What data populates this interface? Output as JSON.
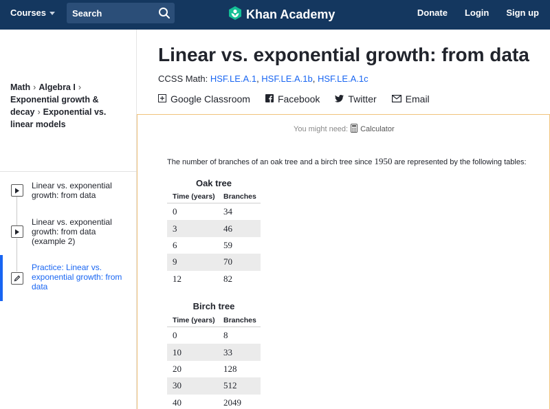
{
  "header": {
    "courses_label": "Courses",
    "search_label": "Search",
    "brand": "Khan Academy",
    "donate": "Donate",
    "login": "Login",
    "signup": "Sign up"
  },
  "breadcrumb": {
    "items": [
      "Math",
      "Algebra I",
      "Exponential growth & decay",
      "Exponential vs. linear models"
    ]
  },
  "sidebar": {
    "items": [
      {
        "icon": "play-icon",
        "label": "Linear vs. exponential growth: from data"
      },
      {
        "icon": "play-icon",
        "label": "Linear vs. exponential growth: from data (example 2)"
      },
      {
        "icon": "pencil-icon",
        "label": "Practice: Linear vs. exponential growth: from data",
        "active": true
      }
    ]
  },
  "main": {
    "title": "Linear vs. exponential growth: from data",
    "ccss_prefix": "CCSS Math: ",
    "ccss_links": [
      "HSF.LE.A.1",
      "HSF.LE.A.1b",
      "HSF.LE.A.1c"
    ],
    "share": {
      "google": "Google Classroom",
      "facebook": "Facebook",
      "twitter": "Twitter",
      "email": "Email"
    },
    "need_prefix": "You might need:",
    "need_tool": "Calculator",
    "problem_before": "The number of branches of an oak tree and a birch tree since ",
    "problem_year": "1950",
    "problem_after": " are represented by the following tables:"
  },
  "tables": {
    "oak": {
      "title": "Oak tree",
      "col1": "Time (years)",
      "col2": "Branches",
      "rows": [
        [
          "0",
          "34"
        ],
        [
          "3",
          "46"
        ],
        [
          "6",
          "59"
        ],
        [
          "9",
          "70"
        ],
        [
          "12",
          "82"
        ]
      ]
    },
    "birch": {
      "title": "Birch tree",
      "col1": "Time (years)",
      "col2": "Branches",
      "rows": [
        [
          "0",
          "8"
        ],
        [
          "10",
          "33"
        ],
        [
          "20",
          "128"
        ],
        [
          "30",
          "512"
        ],
        [
          "40",
          "2049"
        ]
      ]
    }
  },
  "colors": {
    "header_bg": "#14375f",
    "link": "#1865f2",
    "panel_border": "#f1c27a"
  }
}
